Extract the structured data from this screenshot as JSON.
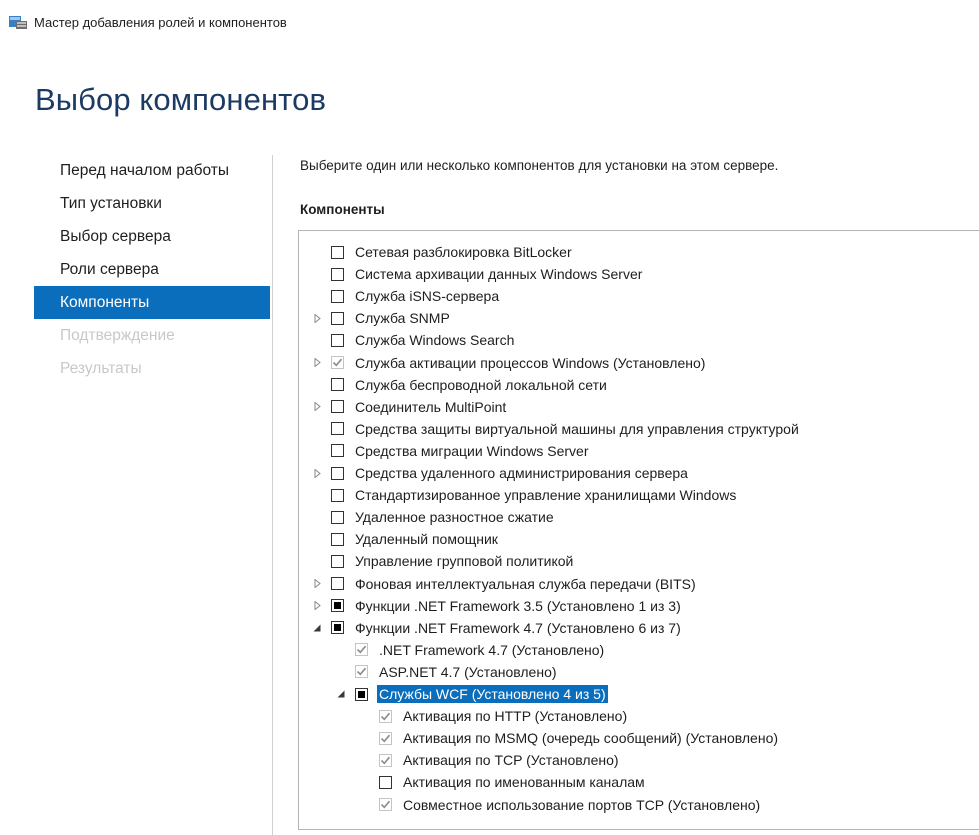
{
  "window": {
    "title": "Мастер добавления ролей и компонентов",
    "icon": "server-manager-wizard-icon"
  },
  "page_title": "Выбор компонентов",
  "nav": {
    "items": [
      {
        "label": "Перед началом работы",
        "state": "normal"
      },
      {
        "label": "Тип установки",
        "state": "normal"
      },
      {
        "label": "Выбор сервера",
        "state": "normal"
      },
      {
        "label": "Роли сервера",
        "state": "normal"
      },
      {
        "label": "Компоненты",
        "state": "active"
      },
      {
        "label": "Подтверждение",
        "state": "disabled"
      },
      {
        "label": "Результаты",
        "state": "disabled"
      }
    ]
  },
  "instruction": "Выберите один или несколько компонентов для установки на этом сервере.",
  "list_label": "Компоненты",
  "colors": {
    "selection": "#0a6ebd",
    "title": "#1c3b64",
    "disabled": "#c8c8c8"
  },
  "components": [
    {
      "label": "Сетевая разблокировка BitLocker",
      "level": 0,
      "expander": "none",
      "check": "unchecked"
    },
    {
      "label": "Система архивации данных Windows Server",
      "level": 0,
      "expander": "none",
      "check": "unchecked"
    },
    {
      "label": "Служба iSNS-сервера",
      "level": 0,
      "expander": "none",
      "check": "unchecked"
    },
    {
      "label": "Служба SNMP",
      "level": 0,
      "expander": "collapsed",
      "check": "unchecked"
    },
    {
      "label": "Служба Windows Search",
      "level": 0,
      "expander": "none",
      "check": "unchecked"
    },
    {
      "label": "Служба активации процессов Windows (Установлено)",
      "level": 0,
      "expander": "collapsed",
      "check": "checked-grey"
    },
    {
      "label": "Служба беспроводной локальной сети",
      "level": 0,
      "expander": "none",
      "check": "unchecked"
    },
    {
      "label": "Соединитель MultiPoint",
      "level": 0,
      "expander": "collapsed",
      "check": "unchecked"
    },
    {
      "label": "Средства защиты виртуальной машины для управления структурой",
      "level": 0,
      "expander": "none",
      "check": "unchecked"
    },
    {
      "label": "Средства миграции Windows Server",
      "level": 0,
      "expander": "none",
      "check": "unchecked"
    },
    {
      "label": "Средства удаленного администрирования сервера",
      "level": 0,
      "expander": "collapsed",
      "check": "unchecked"
    },
    {
      "label": "Стандартизированное управление хранилищами Windows",
      "level": 0,
      "expander": "none",
      "check": "unchecked"
    },
    {
      "label": "Удаленное разностное сжатие",
      "level": 0,
      "expander": "none",
      "check": "unchecked"
    },
    {
      "label": "Удаленный помощник",
      "level": 0,
      "expander": "none",
      "check": "unchecked"
    },
    {
      "label": "Управление групповой политикой",
      "level": 0,
      "expander": "none",
      "check": "unchecked"
    },
    {
      "label": "Фоновая интеллектуальная служба передачи (BITS)",
      "level": 0,
      "expander": "collapsed",
      "check": "unchecked"
    },
    {
      "label": "Функции .NET Framework 3.5 (Установлено 1 из 3)",
      "level": 0,
      "expander": "collapsed",
      "check": "partial"
    },
    {
      "label": "Функции .NET Framework 4.7 (Установлено 6 из 7)",
      "level": 0,
      "expander": "expanded",
      "check": "partial"
    },
    {
      "label": ".NET Framework 4.7 (Установлено)",
      "level": 1,
      "expander": "none",
      "check": "checked-grey"
    },
    {
      "label": "ASP.NET 4.7 (Установлено)",
      "level": 1,
      "expander": "none",
      "check": "checked-grey"
    },
    {
      "label": "Службы WCF (Установлено 4 из 5)",
      "level": 1,
      "expander": "expanded",
      "check": "partial",
      "selected": true
    },
    {
      "label": "Активация по HTTP (Установлено)",
      "level": 2,
      "expander": "none",
      "check": "checked-grey"
    },
    {
      "label": "Активация по MSMQ (очередь сообщений) (Установлено)",
      "level": 2,
      "expander": "none",
      "check": "checked-grey"
    },
    {
      "label": "Активация по TCP (Установлено)",
      "level": 2,
      "expander": "none",
      "check": "checked-grey"
    },
    {
      "label": "Активация по именованным каналам",
      "level": 2,
      "expander": "none",
      "check": "unchecked"
    },
    {
      "label": "Совместное использование портов TCP (Установлено)",
      "level": 2,
      "expander": "none",
      "check": "checked-grey"
    }
  ]
}
